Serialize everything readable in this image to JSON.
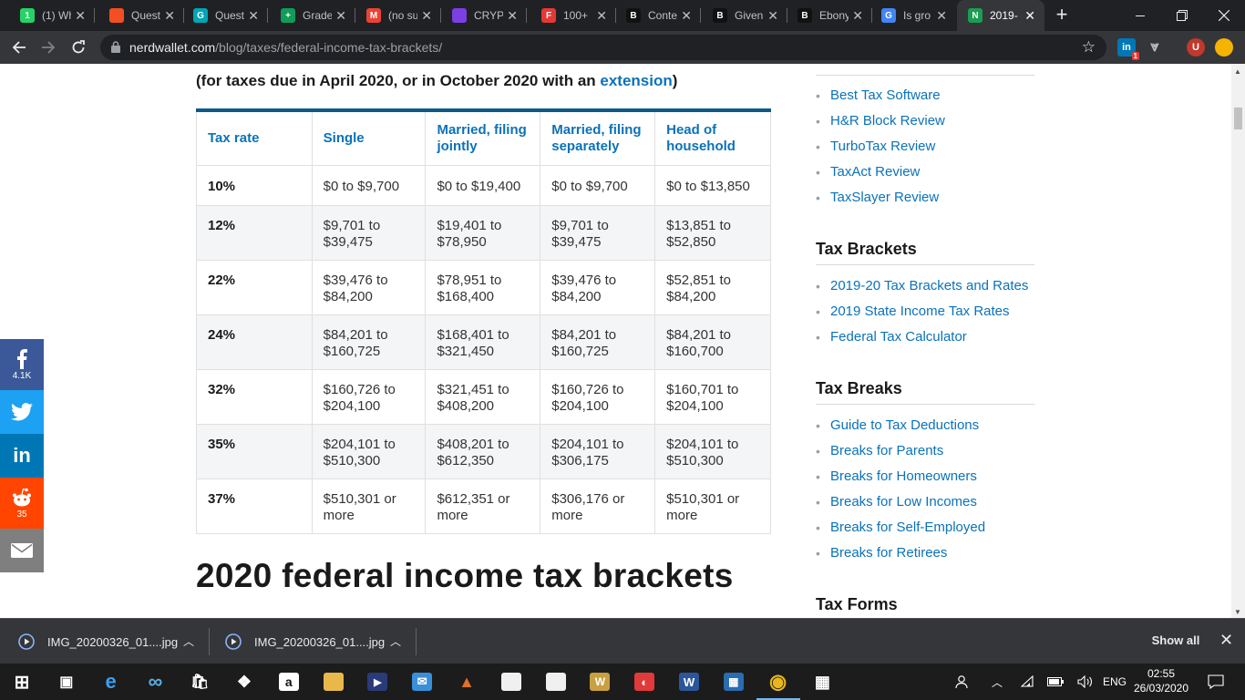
{
  "browser": {
    "tabs": [
      {
        "title": "(1) Wh",
        "fav_text": "1",
        "fav_color": "#25d366"
      },
      {
        "title": "Questi",
        "fav_text": "",
        "fav_color": "#f25022"
      },
      {
        "title": "Questi",
        "fav_text": "G",
        "fav_color": "#00a6b5"
      },
      {
        "title": "Grade",
        "fav_text": "+",
        "fav_color": "#0f9d58"
      },
      {
        "title": "(no su",
        "fav_text": "M",
        "fav_color": "#ea4335"
      },
      {
        "title": "CRYPT",
        "fav_text": "",
        "fav_color": "#7b3fe4"
      },
      {
        "title": "100+",
        "fav_text": "F",
        "fav_color": "#e53935"
      },
      {
        "title": "Conte",
        "fav_text": "B",
        "fav_color": "#111111"
      },
      {
        "title": "Given",
        "fav_text": "B",
        "fav_color": "#111111"
      },
      {
        "title": "Ebony",
        "fav_text": "B",
        "fav_color": "#111111"
      },
      {
        "title": "Is gro",
        "fav_text": "G",
        "fav_color": "#4285f4"
      },
      {
        "title": "2019-",
        "fav_text": "N",
        "fav_color": "#1b9e50"
      }
    ],
    "url_domain": "nerdwallet.com",
    "url_path": "/blog/taxes/federal-income-tax-brackets/",
    "ext_badge": "1",
    "profile_initial": "U"
  },
  "article": {
    "intro_prefix": "(for taxes due in April 2020, or in October 2020 with an ",
    "intro_link": "extension",
    "intro_suffix": ")",
    "table": {
      "headers": [
        "Tax rate",
        "Single",
        "Married, filing jointly",
        "Married, filing separately",
        "Head of household"
      ],
      "rows": [
        [
          "10%",
          "$0 to $9,700",
          "$0 to $19,400",
          "$0 to $9,700",
          "$0 to $13,850"
        ],
        [
          "12%",
          "$9,701 to $39,475",
          "$19,401 to $78,950",
          "$9,701 to $39,475",
          "$13,851 to $52,850"
        ],
        [
          "22%",
          "$39,476 to $84,200",
          "$78,951 to $168,400",
          "$39,476 to $84,200",
          "$52,851 to $84,200"
        ],
        [
          "24%",
          "$84,201 to $160,725",
          "$168,401 to $321,450",
          "$84,201 to $160,725",
          "$84,201 to $160,700"
        ],
        [
          "32%",
          "$160,726 to $204,100",
          "$321,451 to $408,200",
          "$160,726 to $204,100",
          "$160,701 to $204,100"
        ],
        [
          "35%",
          "$204,101 to $510,300",
          "$408,201 to $612,350",
          "$204,101 to $306,175",
          "$204,101 to $510,300"
        ],
        [
          "37%",
          "$510,301 or more",
          "$612,351 or more",
          "$306,176 or more",
          "$510,301 or more"
        ]
      ]
    },
    "next_heading": "2020 federal income tax brackets"
  },
  "sidebar": {
    "reviews": [
      "Best Tax Software",
      "H&R Block Review",
      "TurboTax Review",
      "TaxAct Review",
      "TaxSlayer Review"
    ],
    "brackets_title": "Tax Brackets",
    "brackets": [
      "2019-20 Tax Brackets and Rates",
      "2019 State Income Tax Rates",
      "Federal Tax Calculator"
    ],
    "breaks_title": "Tax Breaks",
    "breaks": [
      "Guide to Tax Deductions",
      "Breaks for Parents",
      "Breaks for Homeowners",
      "Breaks for Low Incomes",
      "Breaks for Self-Employed",
      "Breaks for Retirees"
    ],
    "forms_title": "Tax Forms"
  },
  "share": {
    "facebook_count": "4.1K",
    "reddit_count": "35",
    "colors": {
      "facebook": "#3b5998",
      "twitter": "#1da1f2",
      "linkedin": "#0077b5",
      "reddit": "#ff4500",
      "email": "#7f7f7f"
    }
  },
  "downloads": {
    "items": [
      "IMG_20200326_01....jpg",
      "IMG_20200326_01....jpg"
    ],
    "show_all": "Show all"
  },
  "taskbar": {
    "apps": [
      "start",
      "task-view",
      "edge",
      "infinity",
      "store",
      "dropbox",
      "amazon",
      "file-explorer",
      "media-player",
      "mail",
      "matlab",
      "document",
      "document",
      "word-alt",
      "paint",
      "word",
      "photos",
      "chrome",
      "calculator"
    ],
    "language": "ENG",
    "time": "02:55",
    "date": "26/03/2020"
  }
}
